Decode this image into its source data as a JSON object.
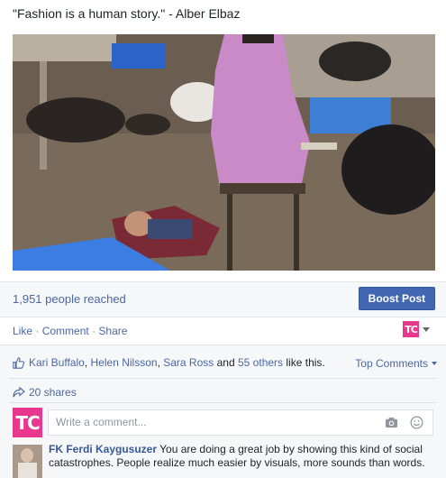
{
  "post": {
    "text": "\"Fashion is a human story.\" - Alber Elbaz"
  },
  "stats": {
    "reach": "1,951 people reached",
    "boost_label": "Boost Post"
  },
  "actions": {
    "like": "Like",
    "comment": "Comment",
    "share": "Share",
    "separator": "·"
  },
  "page_logo": "TC",
  "feedback": {
    "likers": [
      "Kari Buffalo",
      "Helen Nilsson",
      "Sara Ross"
    ],
    "and_text": "and",
    "others": "55 others",
    "suffix": "like this.",
    "comma": ",",
    "top_comments": "Top Comments",
    "shares": "20 shares",
    "comment_placeholder": "Write a comment..."
  },
  "comment": {
    "author": "FK Ferdi Kaygusuzer",
    "text": "You are doing a great job by showing this kind of social catastrophes. People realize much easier by visuals, more sounds than words."
  },
  "colors": {
    "link": "#4b67a1",
    "boost": "#4267b2",
    "brand_pink": "#e8388e"
  },
  "icons": [
    "thumbs-up-icon",
    "share-arrow-icon",
    "camera-icon",
    "smiley-icon",
    "caret-down-icon"
  ]
}
